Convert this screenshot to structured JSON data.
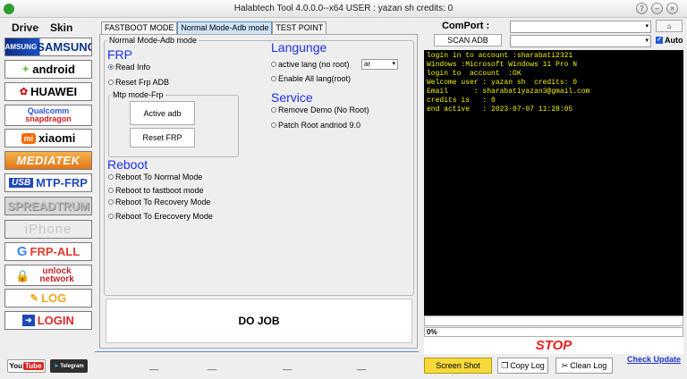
{
  "window": {
    "title": "Halabtech Tool 4.0.0.0--x64   USER : yazan sh  credits: 0",
    "help_glyph": "?",
    "minimize_glyph": "–",
    "maximize_glyph": "□",
    "close_glyph": "×"
  },
  "leftbar": {
    "tabs": [
      "Drive",
      "Skin"
    ],
    "brands": {
      "samsung": {
        "sub": "SAMSUNG",
        "main": "SAMSUNG"
      },
      "android": {
        "icon": "✦",
        "main": "android"
      },
      "huawei": {
        "icon": "✿",
        "main": "HUAWEI"
      },
      "qualcomm": {
        "l1": "Qualcomm",
        "l2": "snapdragon"
      },
      "xiaomi": {
        "icon": "mi",
        "main": "xiaomi"
      },
      "mediatek": {
        "main": "MEDIATEK"
      },
      "usb": {
        "icon": "USB",
        "main": "MTP-FRP"
      },
      "spreadtrum": {
        "main": "SPREADTRUM"
      },
      "iphone": {
        "main": "iPhone"
      },
      "frpall": {
        "icon": "G",
        "main": "FRP-ALL"
      },
      "unlock": {
        "icon": "🔒",
        "text": "unlock network"
      },
      "log": {
        "icon": "✎",
        "main": "LOG"
      },
      "login": {
        "icon": "➜",
        "main": "LOGIN"
      }
    },
    "social": {
      "youtube_a": "You",
      "youtube_b": "Tube",
      "telegram_icon": "➤",
      "telegram": "Telegram"
    }
  },
  "tabs": [
    "FASTBOOT MODE",
    "Normal Mode-Adb mode",
    "TEST POINT"
  ],
  "group_title": "Normal Mode-Adb mode",
  "frp": {
    "heading": "FRP",
    "options": [
      "Read Info",
      "Reset Frp ADB"
    ],
    "mtp_title": "Mtp mode-Frp",
    "active_adb": "Active adb",
    "reset_frp": "Reset FRP"
  },
  "reboot": {
    "heading": "Reboot",
    "options": [
      "Reboot To Normal Mode",
      "Reboot to fastboot mode",
      "Reboot To Recovery Mode",
      "Reboot To Erecovery Mode"
    ]
  },
  "language": {
    "heading": "Langunge",
    "options": [
      "active lang (no root)",
      "Enable All lang(root)"
    ],
    "select_value": "ar"
  },
  "service": {
    "heading": "Service",
    "options": [
      "Remove Demo (No Root)",
      "Patch Root andriod 9.0"
    ]
  },
  "do_job": "DO JOB",
  "underscores": "__",
  "comport": {
    "label": "ComPort :",
    "scan_label": "SCAN ADB",
    "small_btn": "⌂",
    "auto_label": "Auto",
    "arrow": "▾"
  },
  "console_lines": [
    "login in to account :sharabati2321",
    "Windows :Microsoft Windows 11 Pro N",
    "login to  account  :OK",
    "Welcome user : yazan sh  credits: 0",
    "Email      : sharabatiyazan3@gmail.com",
    "credits is   : 0",
    "end active   : 2023-07-07 11:28:05"
  ],
  "progress": {
    "value": 0,
    "label": "0%"
  },
  "stop_label": "STOP",
  "buttons": {
    "screenshot": "Screen Shot",
    "copylog": "Copy Log",
    "cleanlog": "Clean Log",
    "check_update": "Check Update"
  },
  "colors": {
    "accent": "#1c2ee8",
    "console_bg": "#000000",
    "console_text": "#f3f300",
    "stop": "#f01e1e"
  }
}
